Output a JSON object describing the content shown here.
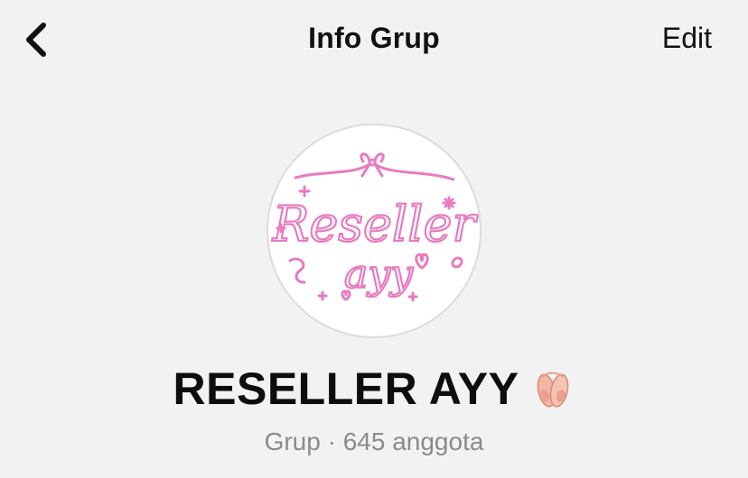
{
  "nav": {
    "back_icon": "chevron-left-icon",
    "title": "Info Grup",
    "edit_label": "Edit"
  },
  "avatar": {
    "logo_text_line1": "Reseller",
    "logo_text_line2": "ayy",
    "logo_color": "#e77bc0",
    "ring_color": "#dcdcdc"
  },
  "group": {
    "name": "RESELLER AYY",
    "emoji_icon": "ballet-shoes-icon",
    "subtitle": "Grup · 645 anggota"
  },
  "colors": {
    "background": "#f2f2f2",
    "text_primary": "#111111",
    "text_secondary": "#8a8a8e"
  }
}
